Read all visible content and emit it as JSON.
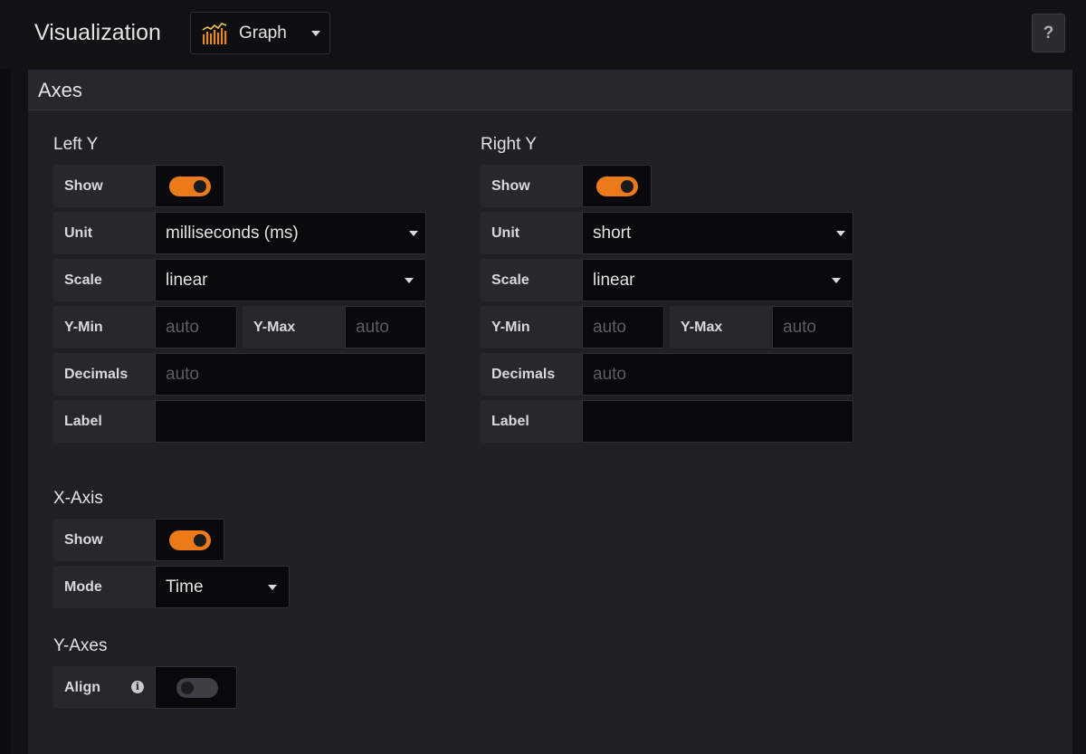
{
  "header": {
    "title": "Visualization",
    "visualization_type": "Graph",
    "help_label": "?"
  },
  "panel": {
    "title": "Axes"
  },
  "left_y": {
    "title": "Left Y",
    "show_label": "Show",
    "show": true,
    "unit_label": "Unit",
    "unit_value": "milliseconds (ms)",
    "scale_label": "Scale",
    "scale_value": "linear",
    "ymin_label": "Y-Min",
    "ymin_placeholder": "auto",
    "ymax_label": "Y-Max",
    "ymax_placeholder": "auto",
    "decimals_label": "Decimals",
    "decimals_placeholder": "auto",
    "label_label": "Label",
    "label_value": ""
  },
  "right_y": {
    "title": "Right Y",
    "show_label": "Show",
    "show": true,
    "unit_label": "Unit",
    "unit_value": "short",
    "scale_label": "Scale",
    "scale_value": "linear",
    "ymin_label": "Y-Min",
    "ymin_placeholder": "auto",
    "ymax_label": "Y-Max",
    "ymax_placeholder": "auto",
    "decimals_label": "Decimals",
    "decimals_placeholder": "auto",
    "label_label": "Label",
    "label_value": ""
  },
  "x_axis": {
    "title": "X-Axis",
    "show_label": "Show",
    "show": true,
    "mode_label": "Mode",
    "mode_value": "Time"
  },
  "y_axes": {
    "title": "Y-Axes",
    "align_label": "Align",
    "align": false
  },
  "colors": {
    "accent": "#eb7b18",
    "background": "#111214",
    "panel": "#1f2024"
  }
}
